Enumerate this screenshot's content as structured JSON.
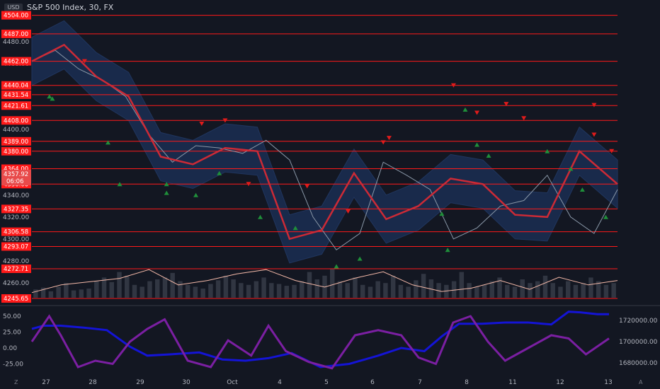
{
  "header": {
    "currency": "USD",
    "title": "S&P 500 Index, 30, FX"
  },
  "colors": {
    "background": "#131722",
    "level_line": "#ff1a1a",
    "label_bg": "#ff1a1a",
    "price_line": "#cc2a36",
    "band": "#1e3a6e",
    "up_marker": "#1f8f3a",
    "down_marker": "#e01b1b",
    "osc_blue": "#1414d6",
    "osc_purple": "#7b1fa2",
    "volume_line": "#f4b9a8"
  },
  "footer": {
    "left_label": "Z",
    "right_label": "A"
  },
  "chart_data": [
    {
      "type": "line",
      "name": "main-price-pane",
      "x_tick_labels": [
        "27",
        "28",
        "29",
        "30",
        "Oct",
        "4",
        "5",
        "6",
        "7",
        "8",
        "11",
        "12",
        "13"
      ],
      "y_tick_labels": [
        "4480.00",
        "4460.00",
        "4440.00",
        "4420.00",
        "4400.00",
        "4380.00",
        "4360.00",
        "4340.00",
        "4320.00",
        "4300.00",
        "4280.00",
        "4260.00"
      ],
      "ylim": [
        4245,
        4505
      ],
      "levels": [
        4504.0,
        4487.0,
        4462.0,
        4440.04,
        4431.54,
        4421.61,
        4408.0,
        4389.0,
        4380.0,
        4364.0,
        4350.0,
        4327.35,
        4306.58,
        4293.07,
        4272.71,
        4245.65
      ],
      "level_labels": [
        "4504.00",
        "4487.00",
        "4462.00",
        "4440.04",
        "4431.54",
        "4421.61",
        "4408.00",
        "4389.00",
        "4380.00",
        "4364.00",
        "4350.00",
        "4327.35",
        "4306.58",
        "4293.07",
        "4272.71",
        "4245.65"
      ],
      "current_price": {
        "value": 4357.92,
        "label": "4357.92",
        "countdown": "06:06"
      },
      "price_series": {
        "x": [
          0,
          0.04,
          0.08,
          0.12,
          0.16,
          0.2,
          0.24,
          0.28,
          0.32,
          0.36,
          0.4,
          0.44,
          0.48,
          0.52,
          0.56,
          0.6,
          0.64,
          0.68,
          0.72,
          0.76,
          0.8,
          0.84,
          0.88,
          0.92,
          0.96,
          1.0
        ],
        "values": [
          4462,
          4472,
          4455,
          4445,
          4430,
          4395,
          4370,
          4385,
          4383,
          4378,
          4390,
          4372,
          4320,
          4290,
          4305,
          4370,
          4358,
          4345,
          4300,
          4310,
          4330,
          4335,
          4358,
          4320,
          4305,
          4345
        ]
      },
      "ma_series": {
        "x": [
          0,
          0.055,
          0.11,
          0.165,
          0.22,
          0.275,
          0.33,
          0.385,
          0.44,
          0.495,
          0.55,
          0.605,
          0.66,
          0.715,
          0.77,
          0.825,
          0.88,
          0.935,
          1.0
        ],
        "values": [
          4462,
          4477,
          4448,
          4430,
          4375,
          4368,
          4383,
          4380,
          4300,
          4308,
          4360,
          4318,
          4330,
          4355,
          4350,
          4322,
          4320,
          4380,
          4350
        ]
      },
      "band_width": 22,
      "up_markers": {
        "x": [
          0.03,
          0.035,
          0.13,
          0.15,
          0.23,
          0.23,
          0.28,
          0.32,
          0.39,
          0.45,
          0.52,
          0.56,
          0.7,
          0.71,
          0.74,
          0.76,
          0.78,
          0.88,
          0.92,
          0.94,
          0.98
        ],
        "values": [
          4430,
          4428,
          4388,
          4350,
          4342,
          4350,
          4340,
          4360,
          4320,
          4310,
          4275,
          4282,
          4323,
          4290,
          4418,
          4386,
          4376,
          4380,
          4364,
          4345,
          4320
        ]
      },
      "down_markers": {
        "x": [
          0.09,
          0.29,
          0.33,
          0.37,
          0.47,
          0.54,
          0.6,
          0.61,
          0.72,
          0.76,
          0.81,
          0.84,
          0.96,
          0.96,
          0.99
        ],
        "values": [
          4462,
          4405,
          4408,
          4350,
          4348,
          4325,
          4388,
          4392,
          4440,
          4415,
          4423,
          4410,
          4422,
          4395,
          4380
        ]
      },
      "volume_line": {
        "x": [
          0,
          0.05,
          0.1,
          0.15,
          0.2,
          0.25,
          0.3,
          0.35,
          0.4,
          0.45,
          0.5,
          0.55,
          0.6,
          0.65,
          0.7,
          0.75,
          0.8,
          0.85,
          0.9,
          0.95,
          1.0
        ],
        "values": [
          4251,
          4258,
          4261,
          4264,
          4272,
          4258,
          4262,
          4268,
          4272,
          4262,
          4256,
          4264,
          4270,
          4258,
          4252,
          4255,
          4262,
          4254,
          4265,
          4258,
          4262
        ]
      },
      "volume_bars": [
        4.5,
        5.5,
        3.5,
        6,
        8,
        4,
        4.5,
        5,
        9,
        11,
        8.5,
        14,
        12,
        7,
        6,
        9,
        10,
        11,
        13.5,
        9,
        7,
        6,
        5,
        7.5,
        9.5,
        12,
        10,
        8,
        7,
        9,
        11,
        8,
        7.5,
        6.5,
        7,
        9,
        14,
        10,
        12,
        16,
        9,
        8,
        11,
        7,
        6,
        9,
        8,
        12,
        7,
        6,
        9.5,
        13,
        10,
        8,
        7,
        9,
        14,
        8,
        6,
        7,
        9,
        11,
        7,
        6,
        10,
        8,
        9,
        12,
        8,
        6,
        9,
        7,
        8,
        11,
        9,
        7,
        8
      ]
    },
    {
      "type": "line",
      "name": "oscillator-pane",
      "y_tick_labels": [
        "50.00",
        "25.00",
        "0.00",
        "-25.00"
      ],
      "ylim": [
        -40,
        60
      ],
      "right_tick_labels": [
        "1720000.00",
        "1700000.00",
        "1680000.00"
      ],
      "right_ylim": [
        1670000,
        1730000
      ],
      "series": [
        {
          "x": [
            0,
            0.02,
            0.05,
            0.09,
            0.13,
            0.17,
            0.2,
            0.24,
            0.29,
            0.33,
            0.37,
            0.41,
            0.45,
            0.5,
            0.55,
            0.6,
            0.64,
            0.68,
            0.71,
            0.74,
            0.78,
            0.82,
            0.86,
            0.9,
            0.93,
            0.95,
            0.98,
            1.0
          ],
          "values": [
            30,
            35,
            35,
            32,
            28,
            2,
            -12,
            -10,
            -7,
            -18,
            -20,
            -16,
            -8,
            -30,
            -25,
            -12,
            0,
            -5,
            18,
            38,
            38,
            40,
            40,
            37,
            57,
            56,
            53,
            53
          ]
        },
        {
          "x": [
            0,
            0.03,
            0.05,
            0.08,
            0.11,
            0.14,
            0.17,
            0.2,
            0.23,
            0.27,
            0.31,
            0.34,
            0.38,
            0.41,
            0.44,
            0.48,
            0.52,
            0.56,
            0.6,
            0.64,
            0.67,
            0.7,
            0.73,
            0.76,
            0.79,
            0.82,
            0.86,
            0.9,
            0.93,
            0.96,
            1.0
          ],
          "values": [
            10,
            50,
            20,
            -30,
            -20,
            -25,
            10,
            30,
            45,
            -20,
            -30,
            12,
            -12,
            35,
            -5,
            -22,
            -32,
            20,
            28,
            20,
            -15,
            -25,
            40,
            50,
            10,
            -20,
            0,
            20,
            15,
            -10,
            15
          ]
        }
      ]
    }
  ]
}
